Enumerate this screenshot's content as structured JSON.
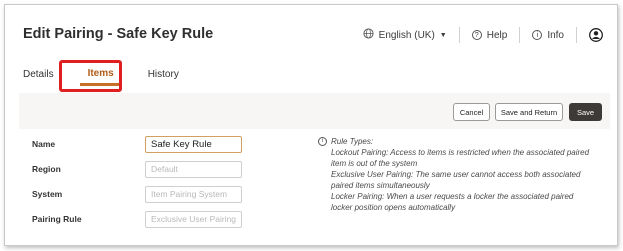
{
  "page": {
    "title": "Edit Pairing - Safe Key Rule"
  },
  "topbar": {
    "language_label": "English (UK)",
    "help_label": "Help",
    "info_label": "Info"
  },
  "tabs": [
    {
      "label": "Details",
      "active": false
    },
    {
      "label": "Items",
      "active": true
    },
    {
      "label": "History",
      "active": false
    }
  ],
  "toolbar": {
    "cancel_label": "Cancel",
    "save_return_label": "Save and Return",
    "save_label": "Save"
  },
  "form": {
    "name": {
      "label": "Name",
      "value": "Safe Key Rule"
    },
    "region": {
      "label": "Region",
      "placeholder": "Default"
    },
    "system": {
      "label": "System",
      "placeholder": "Item Pairing System"
    },
    "pairing_rule": {
      "label": "Pairing Rule",
      "placeholder": "Exclusive User Pairing"
    }
  },
  "rule_types": {
    "heading": "Rule Types:",
    "lines": [
      "Lockout Pairing: Access to items is restricted when the associated paired",
      "item is out of the system",
      "Exclusive User Pairing: The same user cannot access both associated",
      "paired items simultaneously",
      "Locker Pairing: When a user requests a locker the associated paired",
      "locker position opens automatically"
    ]
  },
  "colors": {
    "accent": "#c76f25",
    "highlight_box": "#e02020",
    "save_button": "#3e3a37"
  },
  "icons": [
    "globe-icon",
    "chevron-down-icon",
    "help-icon",
    "info-icon",
    "user-avatar-icon"
  ]
}
